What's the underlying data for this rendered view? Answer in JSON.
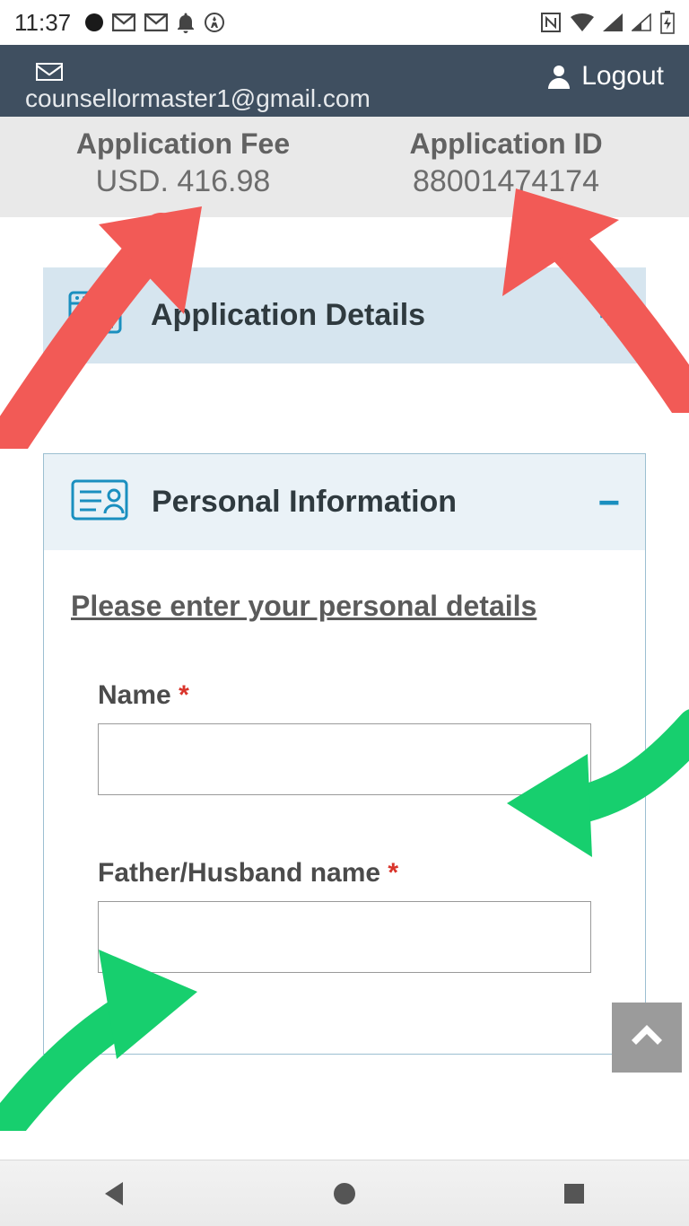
{
  "statusbar": {
    "time": "11:37"
  },
  "header": {
    "email": "counsellormaster1@gmail.com",
    "logout": "Logout"
  },
  "info": {
    "fee_label": "Application Fee",
    "fee_value": "USD. 416.98",
    "id_label": "Application ID",
    "id_value": "88001474174"
  },
  "panels": {
    "app_details": {
      "title": "Application Details",
      "toggle": "+"
    },
    "personal": {
      "title": "Personal Information",
      "toggle": "−",
      "instruction": "Please enter your personal details",
      "fields": {
        "name_label": "Name",
        "father_label": "Father/Husband name"
      }
    }
  },
  "colors": {
    "annotation_red": "#f25a56",
    "annotation_green": "#17cf6e"
  }
}
